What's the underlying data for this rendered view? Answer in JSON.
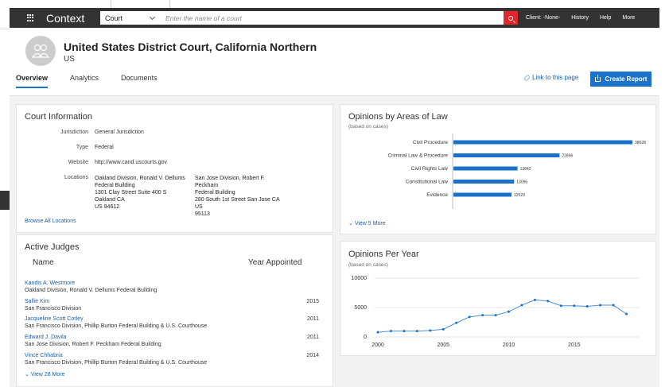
{
  "topbar": {
    "brand": "Context",
    "selector_value": "Court",
    "search_placeholder": "Enter the name of a court",
    "nav": [
      "Client: -None-",
      "History",
      "Help",
      "More"
    ]
  },
  "header": {
    "title": "United States District Court, California Northern",
    "country": "US",
    "tabs": [
      "Overview",
      "Analytics",
      "Documents"
    ],
    "active_tab": "Overview",
    "link_label": "Link to this page",
    "report_label": "Create Report"
  },
  "court_info": {
    "title": "Court Information",
    "jurisdiction_label": "Jurisdiction",
    "jurisdiction": "General Jurisdiction",
    "type_label": "Type",
    "type": "Federal",
    "website_label": "Website",
    "website": "http://www.cand.uscourts.gov",
    "locations_label": "Locations",
    "locations": [
      {
        "l1": "Oakland Division, Ronald V. Dellums",
        "l2": "Federal Building",
        "l3": "1301 Clay Street Suite 400 S Oakland CA",
        "l4": "US 94612"
      },
      {
        "l1": "San Jose Division, Robert F. Peckham",
        "l2": "Federal Building",
        "l3": "280 South 1st Street San Jose CA US",
        "l4": "95113"
      }
    ],
    "browse_label": "Browse All Locations"
  },
  "judges": {
    "title": "Active Judges",
    "col_name": "Name",
    "col_year": "Year Appointed",
    "items": [
      {
        "name": "Kandis A. Westmore",
        "location": "Oakland Division, Ronald V. Dellums Federal Building",
        "year": ""
      },
      {
        "name": "Sallie Kim",
        "location": "San Francisco Division",
        "year": "2015"
      },
      {
        "name": "Jacqueline Scott Corley",
        "location": "San Francisco Division, Phillip Burton Federal Building & U.S. Courthouse",
        "year": "2011"
      },
      {
        "name": "Edward J. Davila",
        "location": "San Jose Division, Robert F. Peckham Federal Building",
        "year": "2011"
      },
      {
        "name": "Vince Chhabria",
        "location": "San Francisco Division, Phillip Burton Federal Building & U.S. Courthouse",
        "year": "2014"
      }
    ],
    "view_more": "View 28 More"
  },
  "areas_card": {
    "title": "Opinions by Areas of Law",
    "subtitle": "(based on cases)",
    "view_more": "View 5 More"
  },
  "year_card": {
    "title": "Opinions Per Year",
    "subtitle": "(based on cases)"
  },
  "colors": {
    "accent": "#1a73c8",
    "topbar": "#333333",
    "search_button": "#e0272b"
  },
  "chart_data": [
    {
      "type": "bar",
      "orientation": "horizontal",
      "categories": [
        "Civil Procedure",
        "Criminal Law & Procedure",
        "Civil Rights Law",
        "Constitutional Law",
        "Evidence"
      ],
      "values": [
        38628,
        22896,
        13842,
        13096,
        12529
      ],
      "title": "Opinions by Areas of Law",
      "subtitle": "(based on cases)",
      "xlim": [
        0,
        38628
      ]
    },
    {
      "type": "line",
      "title": "Opinions Per Year",
      "subtitle": "(based on cases)",
      "x": [
        2000,
        2001,
        2002,
        2003,
        2004,
        2005,
        2006,
        2007,
        2008,
        2009,
        2010,
        2011,
        2012,
        2013,
        2014,
        2015,
        2016,
        2017,
        2018,
        2019
      ],
      "y": [
        800,
        1000,
        1000,
        1000,
        1100,
        1300,
        2400,
        3400,
        3700,
        3700,
        4300,
        5400,
        6300,
        6100,
        5300,
        5300,
        5200,
        5400,
        5400,
        3900
      ],
      "xticks": [
        2000,
        2005,
        2010,
        2015
      ],
      "yticks": [
        0,
        5000,
        10000
      ],
      "xlim": [
        2000,
        2020
      ],
      "ylim": [
        0,
        10000
      ],
      "grid": true
    }
  ]
}
